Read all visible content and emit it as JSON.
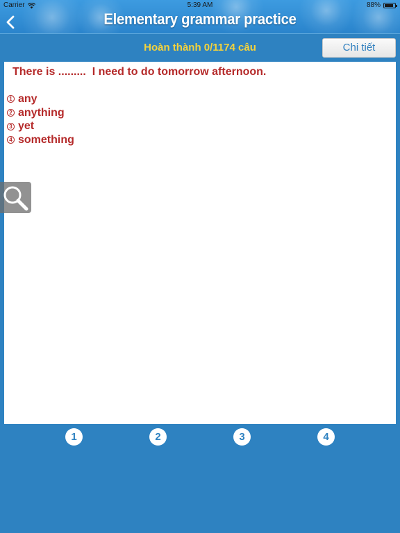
{
  "status_bar": {
    "carrier": "Carrier",
    "time": "5:39 AM",
    "battery": "88%",
    "battery_level": 0.88
  },
  "nav": {
    "title": "Elementary grammar practice",
    "back_icon": "chevron-left-icon"
  },
  "progress": {
    "text": "Hoàn thành 0/1174 câu"
  },
  "detail_button": {
    "label": "Chi tiết"
  },
  "question": {
    "text": "There is .........  I need to do tomorrow afternoon.",
    "options": [
      {
        "number": "1",
        "text": "any"
      },
      {
        "number": "2",
        "text": "anything"
      },
      {
        "number": "3",
        "text": "yet"
      },
      {
        "number": "4",
        "text": "something"
      }
    ]
  },
  "zoom": {
    "icon": "magnifier-icon"
  },
  "answers": [
    "1",
    "2",
    "3",
    "4"
  ],
  "colors": {
    "background": "#2e82c1",
    "title": "#ffffff",
    "progress_text": "#f5d33b",
    "question_text": "#b52a2a",
    "button_text": "#2f7fbf"
  }
}
